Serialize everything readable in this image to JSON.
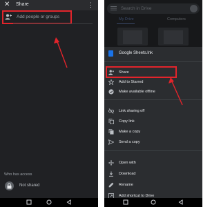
{
  "left": {
    "header": {
      "close_icon": "close-icon",
      "title": "Share",
      "menu_icon": "more-vert-icon"
    },
    "add_field": {
      "icon": "person-add-icon",
      "placeholder": "Add people or groups"
    },
    "access": {
      "label": "Who has access",
      "value": "Not shared",
      "icon": "lock-icon"
    }
  },
  "right": {
    "search": {
      "placeholder": "Search in Drive"
    },
    "tabs": [
      "My Drive",
      "Computers"
    ],
    "file": {
      "name": "Google Sheets.lnk",
      "icon": "sheets-file-icon"
    },
    "menu_items": [
      {
        "label": "Share",
        "icon": "person-add-icon"
      },
      {
        "label": "Add to Starred",
        "icon": "star-icon"
      },
      {
        "label": "Make available offline",
        "icon": "offline-icon"
      },
      {
        "label": "Link sharing off",
        "icon": "link-off-icon"
      },
      {
        "label": "Copy link",
        "icon": "copy-icon"
      },
      {
        "label": "Make a copy",
        "icon": "copy-doc-icon"
      },
      {
        "label": "Send a copy",
        "icon": "send-icon"
      },
      {
        "label": "Open with",
        "icon": "open-with-icon"
      },
      {
        "label": "Download",
        "icon": "download-icon"
      },
      {
        "label": "Rename",
        "icon": "edit-icon"
      },
      {
        "label": "Add shortcut to Drive",
        "icon": "shortcut-icon"
      }
    ]
  },
  "colors": {
    "highlight": "#e3242b",
    "dark_bg": "#202124",
    "sheet_bg": "#2b2d30"
  }
}
